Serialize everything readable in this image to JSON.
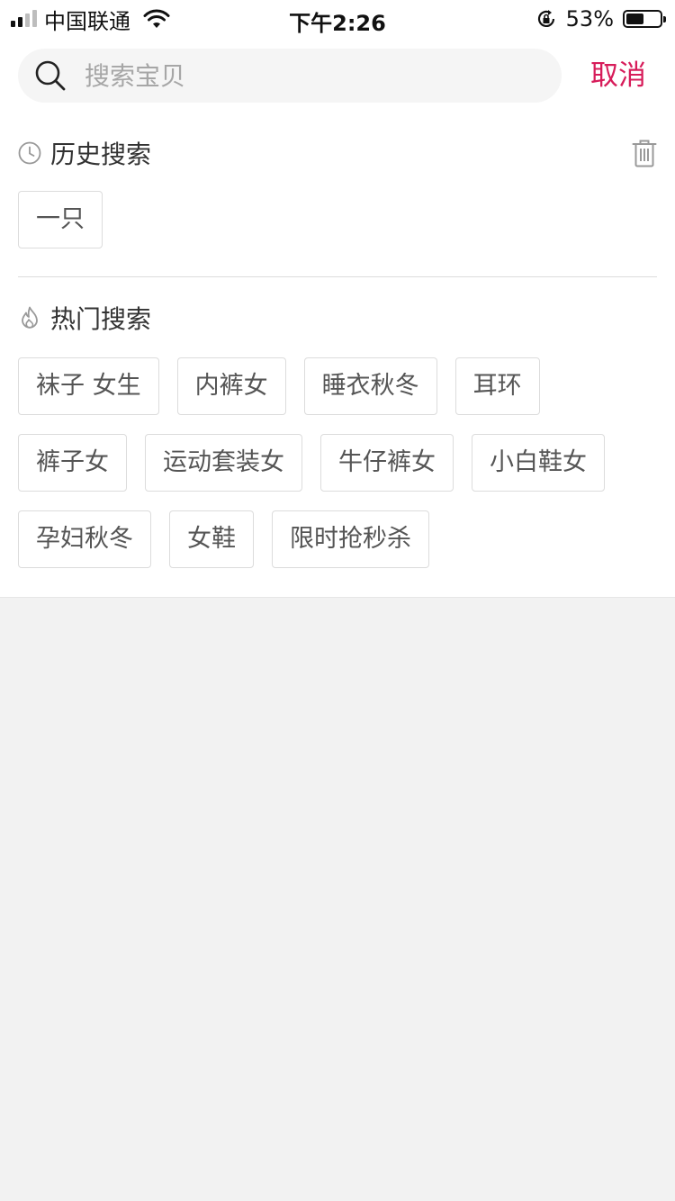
{
  "status_bar": {
    "carrier": "中国联通",
    "time": "下午2:26",
    "battery_percent": "53%",
    "battery_level": 0.53,
    "signal_bars": 4,
    "signal_active": 2,
    "icons": [
      "signal-icon",
      "wifi-icon",
      "orientation-lock-icon",
      "battery-icon"
    ]
  },
  "search": {
    "placeholder": "搜索宝贝",
    "value": "",
    "cancel_label": "取消",
    "icon": "search-icon"
  },
  "history": {
    "title": "历史搜索",
    "icon": "clock-icon",
    "clear_icon": "trash-icon",
    "items": [
      "一只"
    ]
  },
  "hot": {
    "title": "热门搜索",
    "icon": "flame-icon",
    "items": [
      "袜子 女生",
      "内裤女",
      "睡衣秋冬",
      "耳环",
      "裤子女",
      "运动套装女",
      "牛仔裤女",
      "小白鞋女",
      "孕妇秋冬",
      "女鞋",
      "限时抢秒杀"
    ]
  },
  "colors": {
    "accent": "#d71c5a",
    "page_background": "#f2f2f2",
    "search_background": "#f5f5f5",
    "tag_border": "#dcdcdc",
    "tag_text": "#555555"
  }
}
